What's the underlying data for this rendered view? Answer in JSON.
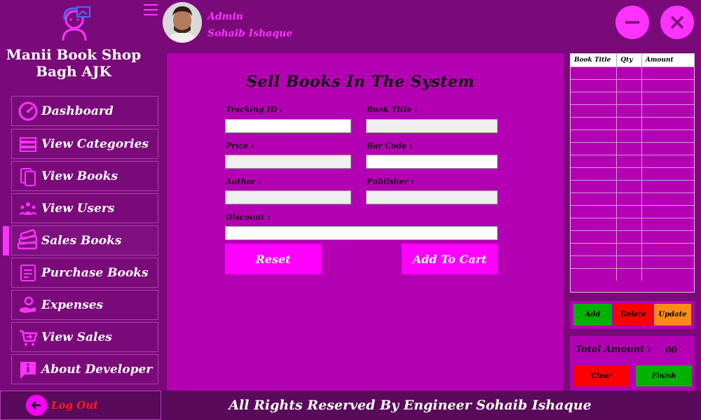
{
  "colors": {
    "accent": "#ff00ff",
    "panel": "#b300b3",
    "background": "#7a0a7a",
    "add": "#00b300",
    "delete": "#ff0000",
    "update": "#ff8c1a"
  },
  "sidebar": {
    "shop_name_line1": "Manii Book Shop",
    "shop_name_line2": "Bagh AJK",
    "items": [
      {
        "label": "Dashboard",
        "icon": "gauge-icon"
      },
      {
        "label": "View Categories",
        "icon": "categories-icon"
      },
      {
        "label": "View Books",
        "icon": "books-icon"
      },
      {
        "label": "View Users",
        "icon": "users-icon"
      },
      {
        "label": "Sales Books",
        "icon": "book-stack-icon"
      },
      {
        "label": "Purchase Books",
        "icon": "receipt-icon"
      },
      {
        "label": "Expenses",
        "icon": "hand-coin-icon"
      },
      {
        "label": "View Sales",
        "icon": "cart-icon"
      },
      {
        "label": "About Developer",
        "icon": "info-icon"
      }
    ],
    "active_item": "Sales Books",
    "logout_label": "Log Out"
  },
  "header": {
    "admin_role": "Admin",
    "admin_name": "Sohaib Ishaque"
  },
  "form": {
    "title": "Sell Books In The System",
    "tracking_id_label": "Tracking ID :",
    "book_title_label": "Book Title :",
    "price_label": "Price :",
    "bar_code_label": "Bar Code :",
    "author_label": "Author :",
    "publisher_label": "Publisher :",
    "discount_label": "Discount :",
    "tracking_id_value": "",
    "book_title_value": "",
    "price_value": "",
    "bar_code_value": "",
    "author_value": "",
    "publisher_value": "",
    "discount_value": "",
    "reset_label": "Reset",
    "add_to_cart_label": "Add To Cart"
  },
  "cart": {
    "columns": [
      "Book Title",
      "Qty",
      "Amount"
    ],
    "add_label": "Add",
    "delete_label": "Delete",
    "update_label": "Update",
    "total_label": "Total Amount :",
    "total_value": "00",
    "clear_label": "Clear",
    "finish_label": "Finish"
  },
  "footer": {
    "text": "All Rights Reserved By Engineer Sohaib Ishaque"
  }
}
